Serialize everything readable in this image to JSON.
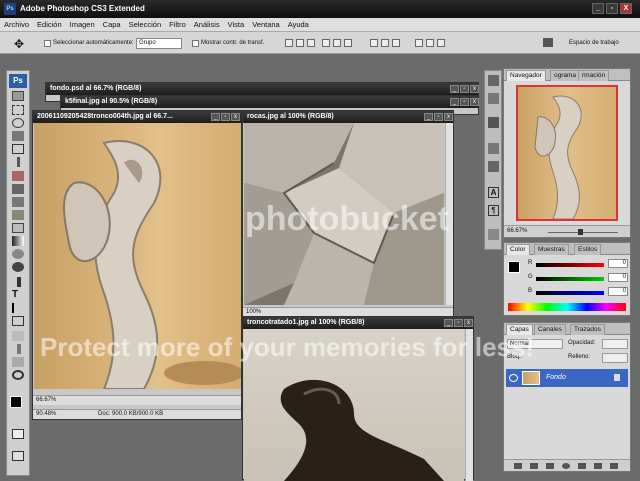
{
  "app": {
    "title": "Adobe Photoshop CS3 Extended",
    "logo": "Ps"
  },
  "window_controls": {
    "minimize": "_",
    "restore": "▫",
    "close": "X"
  },
  "menu": [
    "Archivo",
    "Edición",
    "Imagen",
    "Capa",
    "Selección",
    "Filtro",
    "Análisis",
    "Vista",
    "Ventana",
    "Ayuda"
  ],
  "options": {
    "auto_select_label": "Seleccionar automáticamente:",
    "auto_select_value": "Grupo",
    "show_transform_label": "Mostrar contr. de transf.",
    "workspace_label": "Espacio de trabajo"
  },
  "documents": [
    {
      "title": "fondo.psd al 66.7% (RGB/8)"
    },
    {
      "title": "k5final.jpg al 90.5% (RGB/8)"
    },
    {
      "title": "20061109205428tronco004th.jpg al 66.7...",
      "zoom": "66.67%",
      "status_zoom": "90.48%",
      "doc_info": "Doc: 900.0 KB/900.0 KB"
    },
    {
      "title": "rocas.jpg al 100% (RGB/8)",
      "zoom": "100%"
    },
    {
      "title": "troncotratado1.jpg al 100% (RGB/8)"
    }
  ],
  "navigator": {
    "tabs": [
      "Navegador",
      "ograma",
      "rmación"
    ],
    "zoom": "66.67%"
  },
  "color_panel": {
    "tabs": [
      "Color",
      "Muestras",
      "Estilos"
    ],
    "channels": [
      {
        "label": "R",
        "value": 0
      },
      {
        "label": "G",
        "value": 0
      },
      {
        "label": "B",
        "value": 0
      }
    ]
  },
  "layers_panel": {
    "tabs": [
      "Capas",
      "Canales",
      "Trazados"
    ],
    "blend": "Normal",
    "opacity_label": "Opacidad:",
    "fill_label": "Relleno:",
    "lock_label": "Bloq.:",
    "layer_name": "Fondo"
  },
  "watermark": {
    "line1": "photobucket",
    "line2": "Protect more of your memories for less!"
  },
  "colors": {
    "accent": "#3a66c4",
    "titlebar": "#1d1d1d",
    "wood": "#c9a36b"
  }
}
